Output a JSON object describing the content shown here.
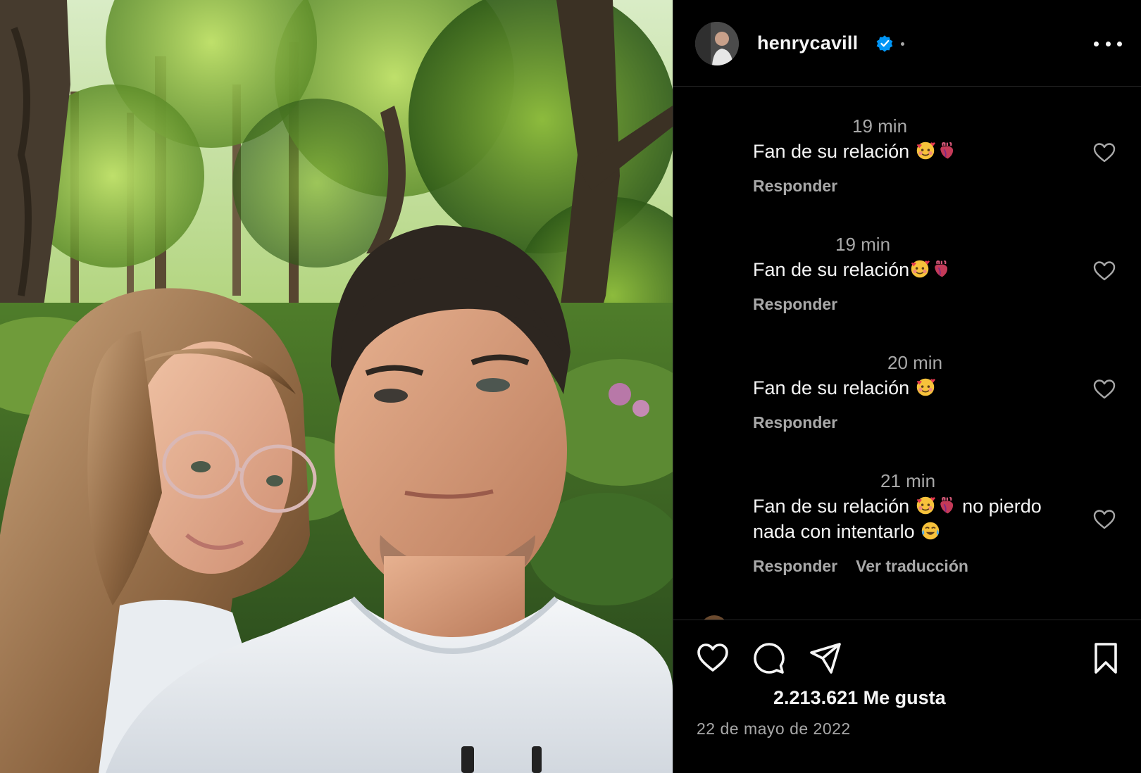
{
  "header": {
    "username": "henrycavill",
    "verified": true,
    "avatar_icon": "profile-avatar"
  },
  "comments": [
    {
      "time": "19 min",
      "text_before": "Fan de su relación ",
      "emojis": [
        "smiling-face-with-hearts",
        "anatomical-heart"
      ],
      "text_after": "",
      "reply_label": "Responder"
    },
    {
      "time": "19 min",
      "text_before": "Fan de su relación",
      "emojis": [
        "smiling-face-with-hearts",
        "anatomical-heart"
      ],
      "text_after": "",
      "reply_label": "Responder"
    },
    {
      "time": "20 min",
      "text_before": "Fan de su relación ",
      "emojis": [
        "smiling-face-with-hearts"
      ],
      "text_after": "",
      "reply_label": "Responder"
    },
    {
      "time": "21 min",
      "line1_before": "Fan de su relación ",
      "line1_after": " no pierdo",
      "line2": "nada con intentarlo ",
      "reply_label": "Responder",
      "translate_label": "Ver traducción"
    }
  ],
  "footer": {
    "likes": "2.213.621 Me gusta",
    "date": "22 de mayo de 2022"
  },
  "colors": {
    "background": "#000000",
    "text_primary": "#f5f5f5",
    "text_secondary": "#a8a8a8",
    "divider": "#262626",
    "verified_blue": "#0095f6"
  }
}
